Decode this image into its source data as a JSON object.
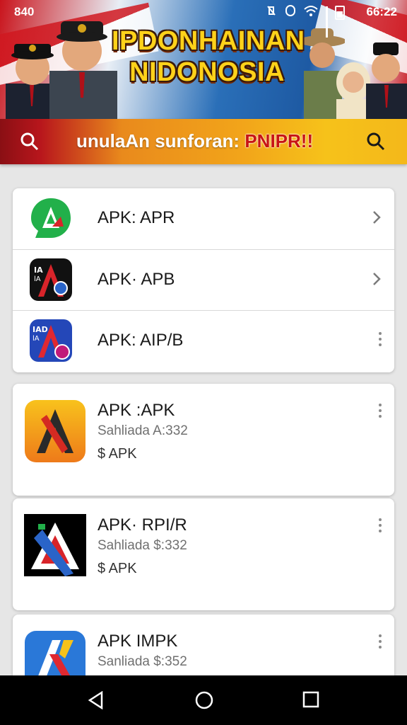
{
  "status_bar": {
    "time_left": "840",
    "time_right": "66:22"
  },
  "banner": {
    "title_line1": "IPDONHAINAN",
    "title_line2": "NIDONOSIA"
  },
  "search": {
    "text_prefix": "unulaAn sunforan: ",
    "text_highlight": "PNIPR!!"
  },
  "list_rows": [
    {
      "label": "APK: APR",
      "trail": "chevron-right"
    },
    {
      "label": "APK· APB",
      "trail": "chevron-right"
    },
    {
      "label": "APK: AIP/B",
      "trail": "more-vertical"
    }
  ],
  "apps": [
    {
      "name": "APK :APK",
      "sub": "Sahliada A:332",
      "price": "$ APK",
      "color": "#f29a1c"
    },
    {
      "name": "APK· RPI/R",
      "sub": "Sahliada $:332",
      "price": "$ APK",
      "color": "#000000"
    },
    {
      "name": "APK IMPK",
      "sub": "Sanliada $:352",
      "price": "",
      "color": "#2a78d8"
    }
  ],
  "icon_tiles": {
    "row2_tile": [
      "IA",
      "lA"
    ],
    "row3_tile": [
      "IAD",
      "lA"
    ]
  },
  "colors": {
    "banner_red": "#c9141c",
    "banner_title": "#ffd21a",
    "search_gradient_end": "#f6c21a",
    "nav_bg": "#000000"
  }
}
